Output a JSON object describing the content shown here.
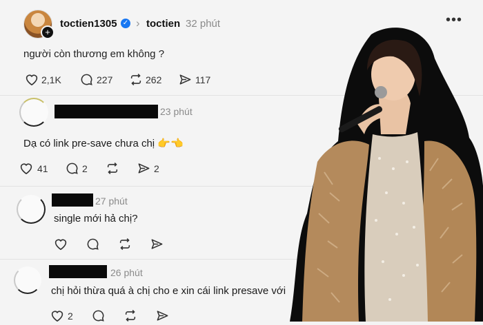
{
  "post": {
    "username": "toctien1305",
    "thread_name": "toctien",
    "time": "32 phút",
    "text": "người còn thương em không ?",
    "stats": {
      "likes": "2,1K",
      "comments": "227",
      "reposts": "262",
      "shares": "117"
    }
  },
  "replies": [
    {
      "time": "23 phút",
      "text": "Dạ có link pre-save chưa chị 👉👈",
      "stats": {
        "likes": "41",
        "comments": "2",
        "reposts": "",
        "shares": "2"
      }
    },
    {
      "time": "27 phút",
      "text": "single mới hả chị?",
      "stats": {
        "likes": "",
        "comments": "",
        "reposts": "",
        "shares": ""
      }
    },
    {
      "time": "26 phút",
      "text": "chị hỏi thừa quá à chị cho e xin cái link presave với",
      "stats": {
        "likes": "2",
        "comments": "",
        "reposts": "",
        "shares": ""
      }
    }
  ],
  "colors": {
    "background": "#f4f4f4",
    "verified": "#1877f2",
    "redaction": "#0a0a0a"
  },
  "icons": [
    "heart-icon",
    "comment-icon",
    "repost-icon",
    "send-icon",
    "verified-icon",
    "more-icon",
    "chevron-right-icon",
    "plus-icon"
  ]
}
